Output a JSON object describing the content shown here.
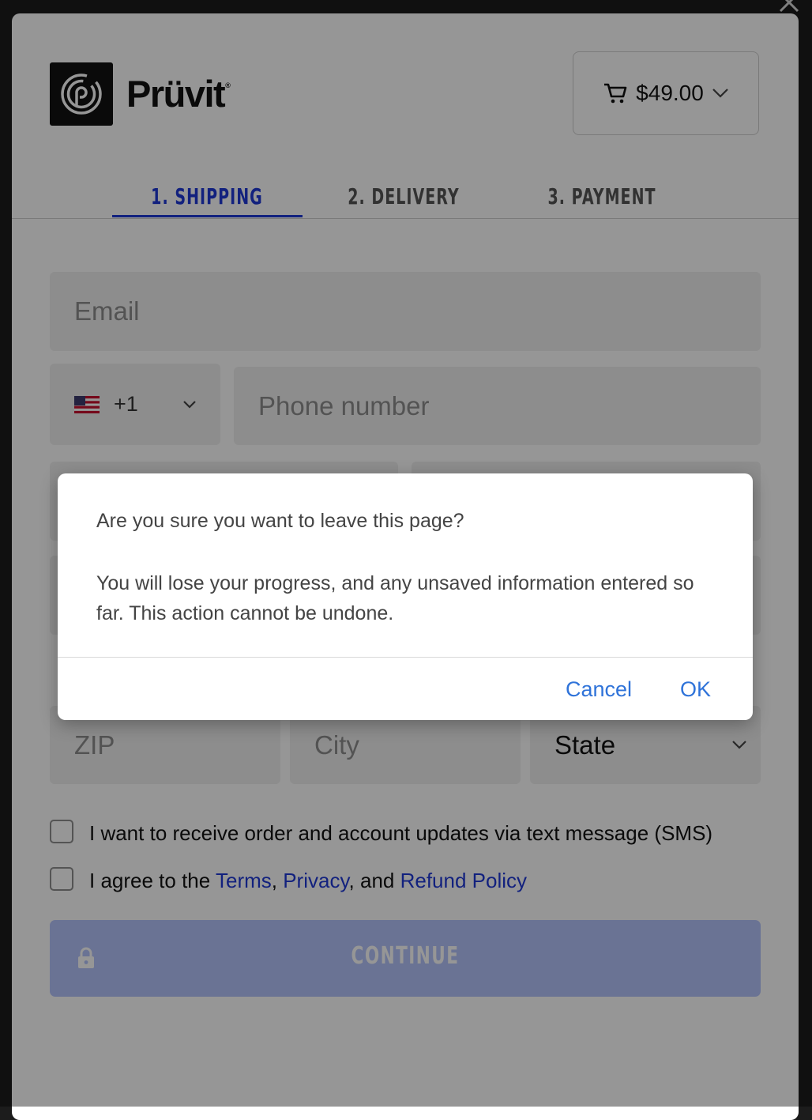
{
  "header": {
    "brand": "Prüvit",
    "brand_mark": "®",
    "cart_total": "$49.00"
  },
  "steps": [
    {
      "label": "1. SHIPPING",
      "active": true
    },
    {
      "label": "2. DELIVERY",
      "active": false
    },
    {
      "label": "3. PAYMENT",
      "active": false
    }
  ],
  "form": {
    "email_placeholder": "Email",
    "country_code": "+1",
    "phone_placeholder": "Phone number",
    "zip_placeholder": "ZIP",
    "city_placeholder": "City",
    "state_value": "State"
  },
  "consent": {
    "sms_label": "I want to receive order and account updates via text message (SMS)",
    "terms_prefix": "I agree to the ",
    "terms_link": "Terms",
    "sep1": ", ",
    "privacy_link": "Privacy",
    "sep2": ", and ",
    "refund_link": "Refund Policy"
  },
  "continue_label": "CONTINUE",
  "dialog": {
    "question": "Are you sure you want to leave this page?",
    "message": "You will lose your progress, and any unsaved information entered so far. This action cannot be undone.",
    "cancel": "Cancel",
    "ok": "OK"
  },
  "colors": {
    "accent": "#2038d6",
    "dialog_button": "#2f73d9",
    "continue_disabled": "#b5c4fb"
  }
}
